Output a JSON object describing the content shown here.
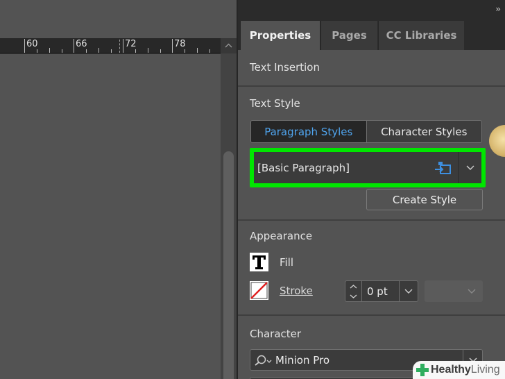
{
  "ruler": {
    "labels": [
      "60",
      "66",
      "72",
      "78"
    ]
  },
  "panel": {
    "collapse_glyph": "››",
    "tabs": [
      {
        "label": "Properties",
        "active": true
      },
      {
        "label": "Pages",
        "active": false
      },
      {
        "label": "CC Libraries",
        "active": false
      }
    ]
  },
  "text_insertion": {
    "title": "Text Insertion"
  },
  "text_style": {
    "title": "Text Style",
    "segments": [
      {
        "label": "Paragraph Styles",
        "active": true
      },
      {
        "label": "Character Styles",
        "active": false
      }
    ],
    "current_style": "[Basic Paragraph]",
    "create_style_label": "Create Style"
  },
  "appearance": {
    "title": "Appearance",
    "fill_label": "Fill",
    "stroke_label": "Stroke",
    "stroke_weight": "0 pt"
  },
  "character": {
    "title": "Character",
    "font_family": "Minion Pro"
  },
  "watermark": {
    "part1": "Healthy",
    "part2": "Living"
  },
  "colors": {
    "highlight": "#00e600",
    "active_tab_text": "#4fa3ec",
    "panel_bg": "#535353"
  }
}
